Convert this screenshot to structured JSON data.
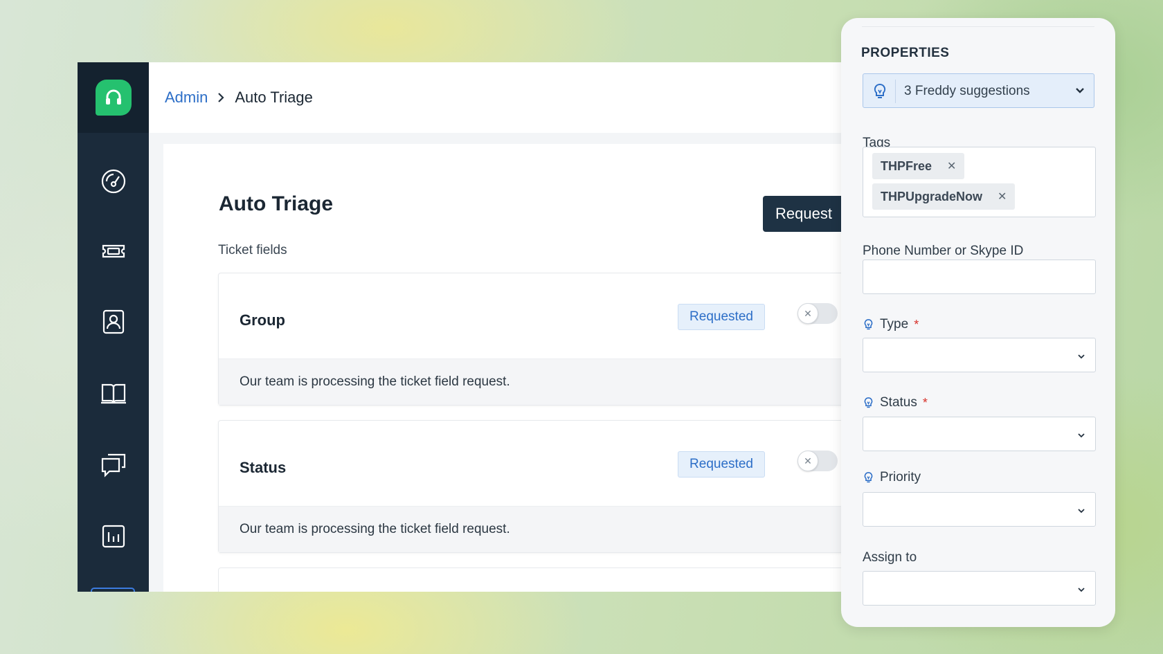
{
  "breadcrumb": {
    "admin": "Admin",
    "current": "Auto Triage"
  },
  "sidebar": {
    "logo_icon": "headset-icon",
    "items": [
      {
        "icon": "dashboard-icon"
      },
      {
        "icon": "ticket-icon"
      },
      {
        "icon": "contacts-icon"
      },
      {
        "icon": "book-icon"
      },
      {
        "icon": "chat-icon"
      },
      {
        "icon": "reports-icon"
      }
    ]
  },
  "main": {
    "title": "Auto Triage",
    "request_button": "Request",
    "section_label": "Ticket fields",
    "fields": [
      {
        "name": "Group",
        "badge": "Requested",
        "toggle_on": false,
        "note": "Our team is processing the ticket field request."
      },
      {
        "name": "Status",
        "badge": "Requested",
        "toggle_on": false,
        "note": "Our team is processing the ticket field request."
      }
    ]
  },
  "properties": {
    "heading": "PROPERTIES",
    "freddy": "3 Freddy suggestions",
    "tags_label": "Tags",
    "tags": [
      "THPFree",
      "THPUpgradeNow"
    ],
    "phone_label": "Phone Number or Skype ID",
    "phone_value": "",
    "type_label": "Type",
    "status_label": "Status",
    "priority_label": "Priority",
    "assign_label": "Assign to",
    "required_mark": "*"
  },
  "colors": {
    "sidebar": "#1b2b3b",
    "brand_green": "#25c16f",
    "link_blue": "#2c6ec7",
    "primary_button": "#1e3244",
    "required_red": "#d7312a"
  }
}
